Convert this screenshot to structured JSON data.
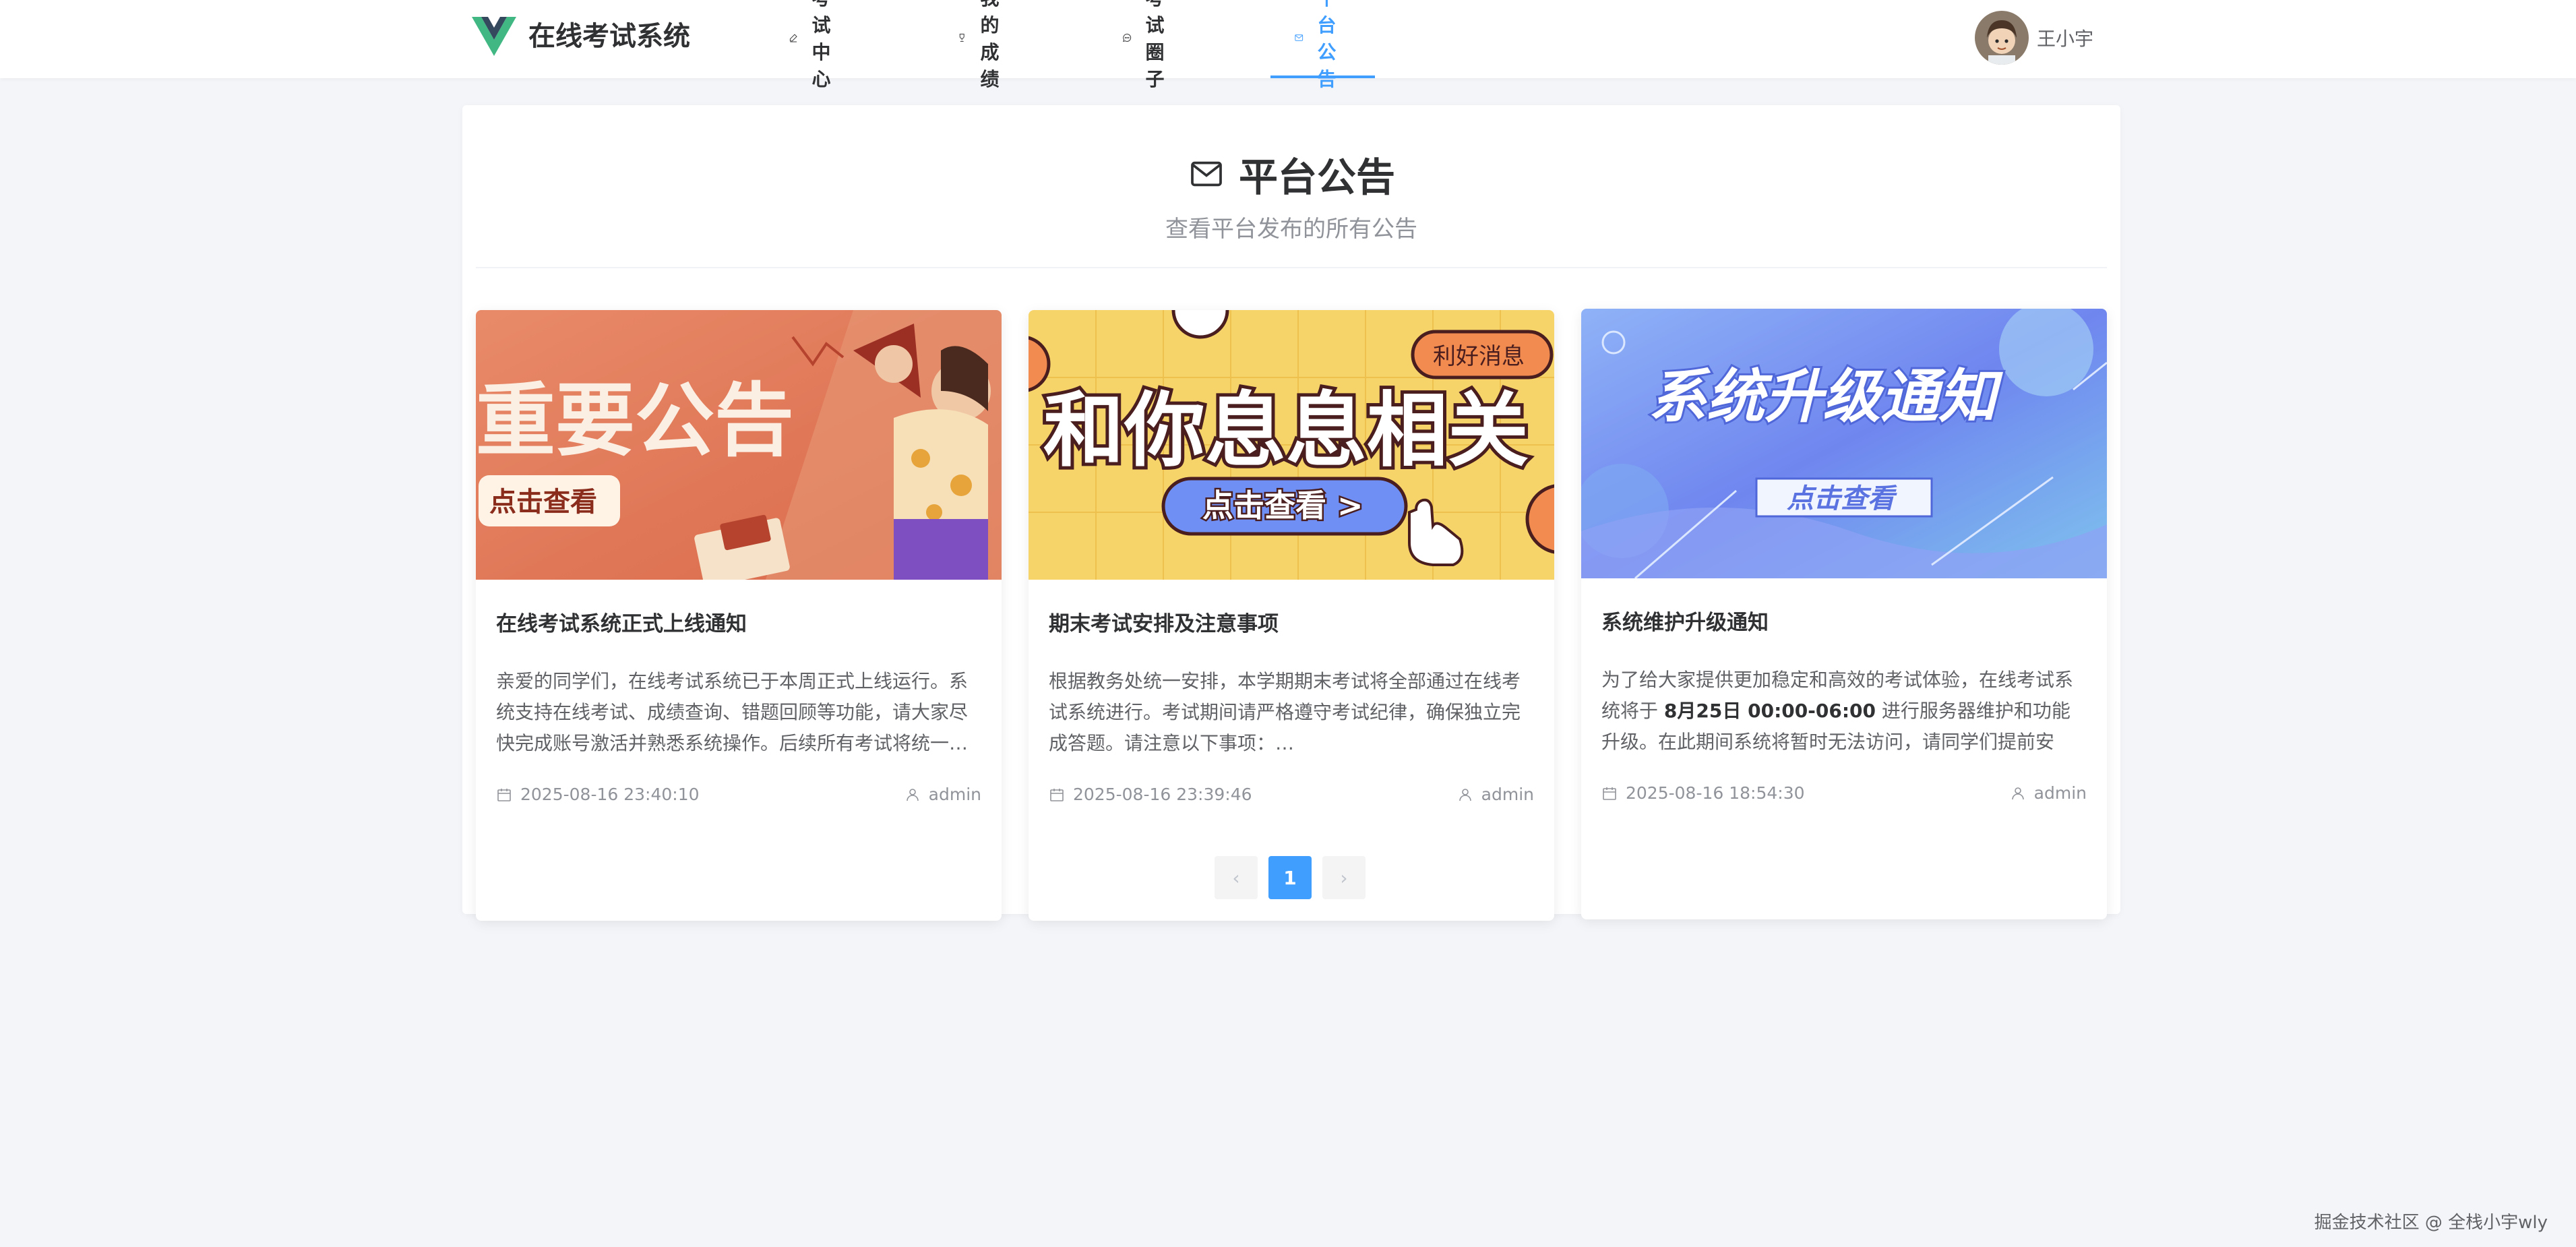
{
  "app": {
    "title": "在线考试系统"
  },
  "nav": {
    "items": [
      {
        "label": "考试中心",
        "icon": "edit-icon",
        "active": false
      },
      {
        "label": "我的成绩",
        "icon": "trophy-icon",
        "active": false
      },
      {
        "label": "考试圈子",
        "icon": "chat-icon",
        "active": false
      },
      {
        "label": "平台公告",
        "icon": "mail-icon",
        "active": true
      }
    ],
    "active_color": "#409eff"
  },
  "user": {
    "name": "王小宇"
  },
  "page": {
    "title": "平台公告",
    "subtitle": "查看平台发布的所有公告"
  },
  "announcements": [
    {
      "banner_text": "重要公告",
      "banner_button": "点击查看",
      "title": "在线考试系统正式上线通知",
      "body": "亲爱的同学们，在线考试系统已于本周正式上线运行。系统支持在线考试、成绩查询、错题回顾等功能，请大家尽快完成账号激活并熟悉系统操作。后续所有考试将统一…",
      "date": "2025-08-16 23:40:10",
      "author": "admin"
    },
    {
      "banner_text": "和你息息相关",
      "banner_badge": "利好消息",
      "banner_button": "点击查看 >",
      "title": "期末考试安排及注意事项",
      "body": "根据教务处统一安排，本学期期末考试将全部通过在线考试系统进行。考试期间请严格遵守考试纪律，确保独立完成答题。请注意以下事项：…",
      "date": "2025-08-16 23:39:46",
      "author": "admin"
    },
    {
      "banner_text": "系统升级通知",
      "banner_button": "点击查看",
      "title": "系统维护升级通知",
      "body_pre": "为了给大家提供更加稳定和高效的考试体验，在线考试系统将于 ",
      "body_strong": "8月25日 00:00-06:00",
      "body_post": " 进行服务器维护和功能升级。在此期间系统将暂时无法访问，请同学们提前安排…",
      "date": "2025-08-16 18:54:30",
      "author": "admin"
    }
  ],
  "pagination": {
    "prev": "‹",
    "current": "1",
    "next": "›"
  },
  "watermark": "掘金技术社区 @ 全栈小宇wly"
}
